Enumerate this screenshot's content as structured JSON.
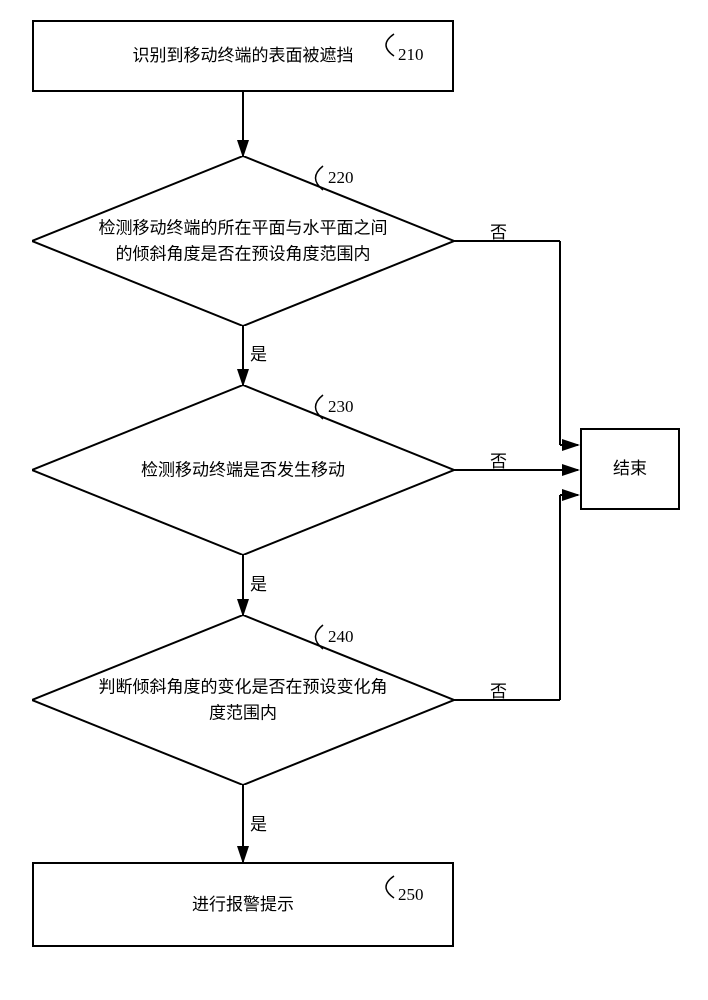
{
  "chart_data": {
    "type": "flowchart",
    "nodes": [
      {
        "id": "210",
        "type": "process",
        "text": "识别到移动终端的表面被遮挡",
        "label": "210"
      },
      {
        "id": "220",
        "type": "decision",
        "text": "检测移动终端的所在平面与水平面之间的倾斜角度是否在预设角度范围内",
        "label": "220"
      },
      {
        "id": "230",
        "type": "decision",
        "text": "检测移动终端是否发生移动",
        "label": "230"
      },
      {
        "id": "240",
        "type": "decision",
        "text": "判断倾斜角度的变化是否在预设变化角度范围内",
        "label": "240"
      },
      {
        "id": "250",
        "type": "process",
        "text": "进行报警提示",
        "label": "250"
      },
      {
        "id": "end",
        "type": "terminator",
        "text": "结束"
      }
    ],
    "edges": [
      {
        "from": "210",
        "to": "220",
        "label": ""
      },
      {
        "from": "220",
        "to": "230",
        "label": "是"
      },
      {
        "from": "220",
        "to": "end",
        "label": "否"
      },
      {
        "from": "230",
        "to": "240",
        "label": "是"
      },
      {
        "from": "230",
        "to": "end",
        "label": "否"
      },
      {
        "from": "240",
        "to": "250",
        "label": "是"
      },
      {
        "from": "240",
        "to": "end",
        "label": "否"
      }
    ]
  },
  "node_210_text": "识别到移动终端的表面被遮挡",
  "node_210_label": "210",
  "node_220_text": "检测移动终端的所在平面与水平面之间的倾斜角度是否在预设角度范围内",
  "node_220_label": "220",
  "node_230_text": "检测移动终端是否发生移动",
  "node_230_label": "230",
  "node_240_text": "判断倾斜角度的变化是否在预设变化角度范围内",
  "node_240_label": "240",
  "node_250_text": "进行报警提示",
  "node_250_label": "250",
  "node_end_text": "结束",
  "edge_yes": "是",
  "edge_no": "否"
}
